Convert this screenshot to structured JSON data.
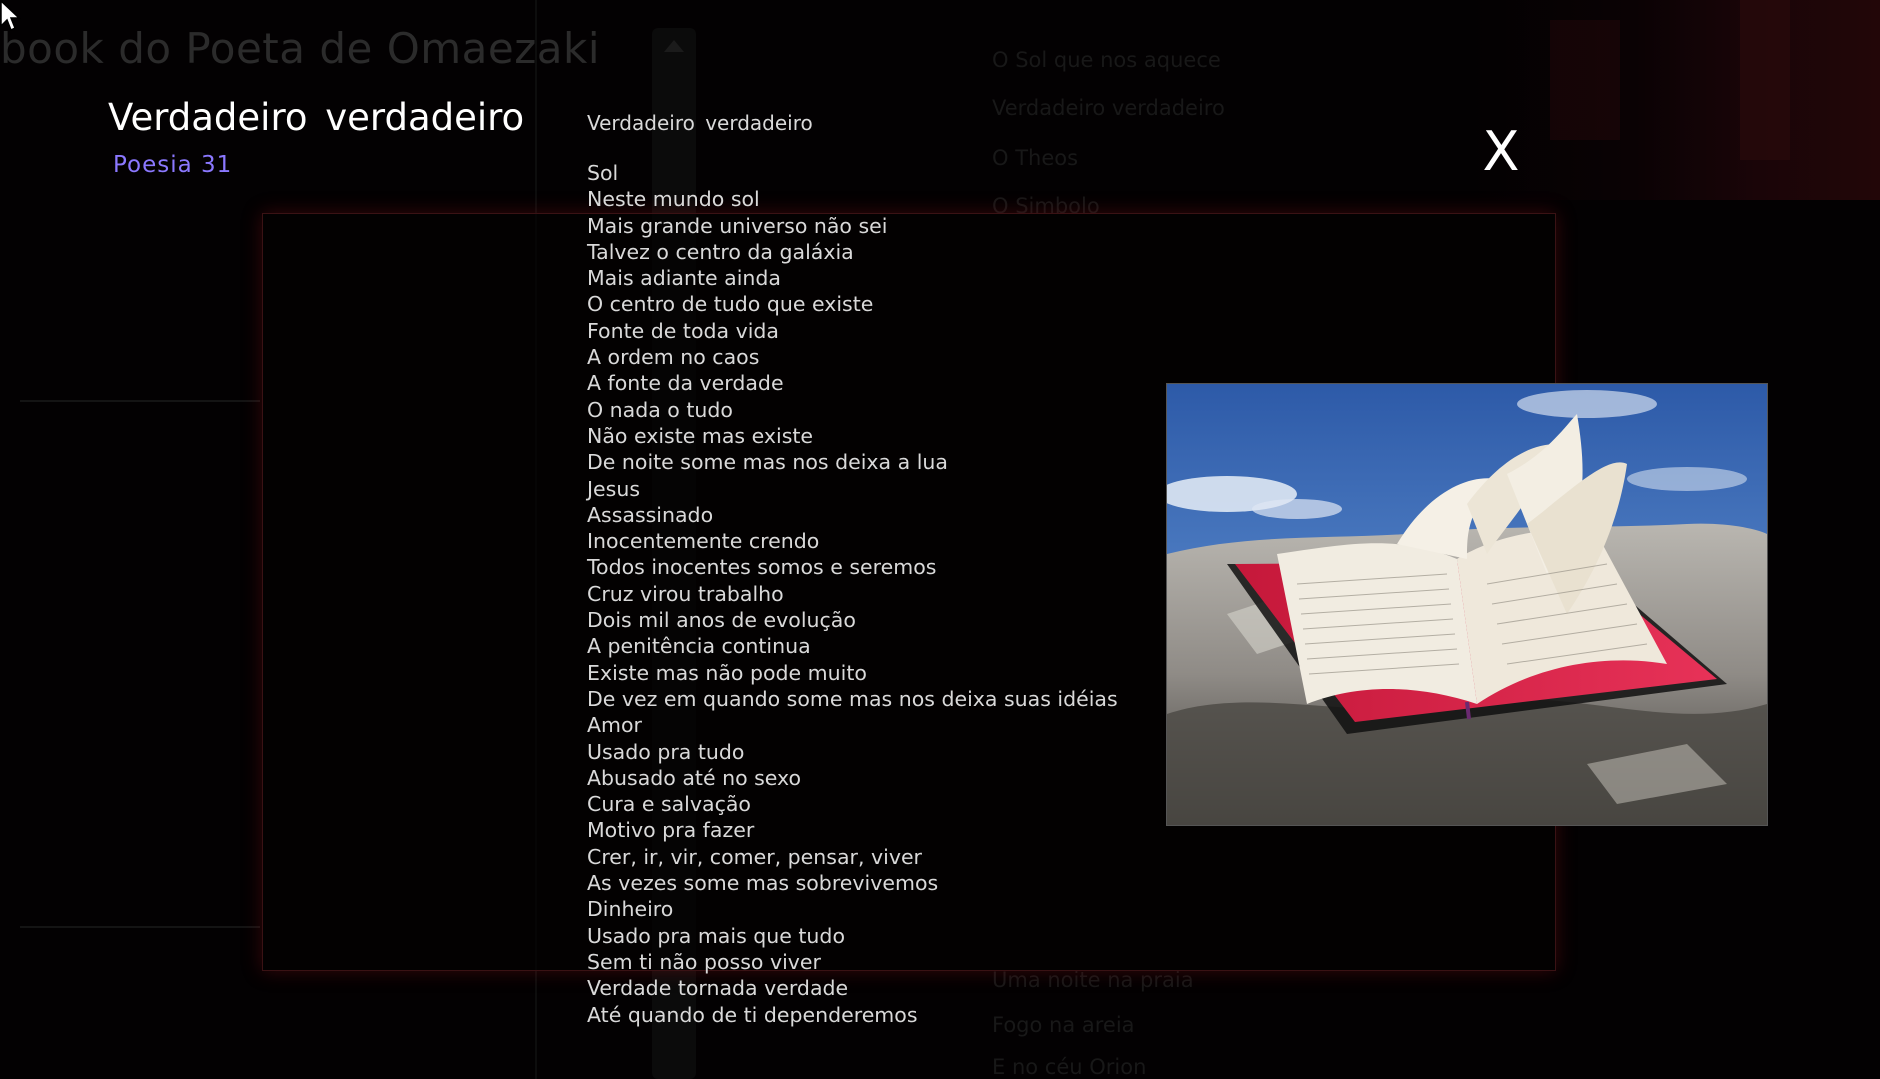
{
  "background": {
    "app_title": "book do Poeta de Omaezaki",
    "list_items": [
      "O Sol que nos aquece",
      "Verdadeiro  verdadeiro",
      "O Theos",
      "O Simbolo",
      "Uma noite na praia",
      "Fogo na areia",
      "E no céu Orion"
    ]
  },
  "header": {
    "title": "Verdadeiro  verdadeiro",
    "subtitle": "Poesia 31"
  },
  "close_button": {
    "label": "X"
  },
  "poem": {
    "title": "Verdadeiro  verdadeiro",
    "lines": [
      "Sol",
      "Neste mundo sol",
      "Mais grande universo não sei",
      "Talvez o centro da galáxia",
      "Mais adiante ainda",
      "O centro de tudo que existe",
      "Fonte de toda vida",
      "A ordem no caos",
      "A fonte da verdade",
      "O nada o tudo",
      "Não existe mas existe",
      "De noite some mas nos deixa a lua",
      "Jesus",
      "Assassinado",
      "Inocentemente crendo",
      "Todos inocentes somos e seremos",
      "Cruz virou trabalho",
      "Dois mil anos de evolução",
      "A penitência continua",
      "Existe mas não pode muito",
      "De vez em quando some mas nos deixa suas idéias",
      "Amor",
      "Usado pra tudo",
      "Abusado até no sexo",
      "Cura e salvação",
      "Motivo pra fazer",
      "Crer, ir, vir, comer, pensar, viver",
      "As vezes some mas sobrevivemos",
      "Dinheiro",
      "Usado pra mais que tudo",
      "Sem ti não posso viver",
      "Verdade tornada verdade",
      "Até quando de ti dependeremos"
    ]
  },
  "image": {
    "subject": "open-book-on-rock-photo"
  },
  "colors": {
    "background": "#030102",
    "header_title": "#ffffff",
    "header_subtitle": "#8b78ff",
    "poem_text": "#d9d9d9",
    "frame_glow": "#961419"
  },
  "icons": {
    "close": "close-icon",
    "cursor": "mouse-pointer-icon",
    "scroll_up": "chevron-up-icon"
  }
}
